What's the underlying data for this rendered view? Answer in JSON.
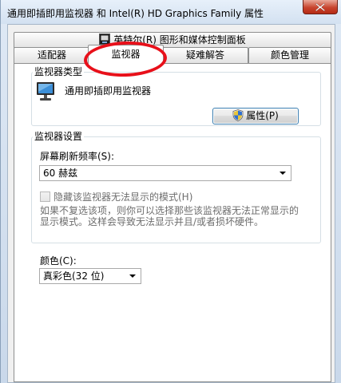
{
  "window": {
    "title": "通用即插即用监视器 和 Intel(R) HD Graphics Family 属性"
  },
  "tabs": {
    "row1": [
      {
        "label": "英特尔(R) 图形和媒体控制面板",
        "icon": "intel-graphics-icon"
      }
    ],
    "row2": [
      {
        "label": "适配器"
      },
      {
        "label": "监视器",
        "active": true
      },
      {
        "label": "疑难解答"
      },
      {
        "label": "颜色管理"
      }
    ]
  },
  "monitor_type": {
    "group_label": "监视器类型",
    "monitor_name": "通用即插即用监视器",
    "properties_button": "属性(P)"
  },
  "monitor_settings": {
    "group_label": "监视器设置",
    "refresh_label": "屏幕刷新频率(S):",
    "refresh_value": "60 赫兹",
    "hide_modes_label": "隐藏该监视器无法显示的模式(H)",
    "hint_line1": "如果不复选该项，则你可以选择那些该监视器无法正常显示的",
    "hint_line2": "显示模式。这样会导致无法显示并且/或者损坏硬件。"
  },
  "color": {
    "label": "颜色(C):",
    "value": "真彩色(32 位)"
  },
  "colors": {
    "annotation": "#e8101a",
    "close_button": "#c8452f"
  }
}
